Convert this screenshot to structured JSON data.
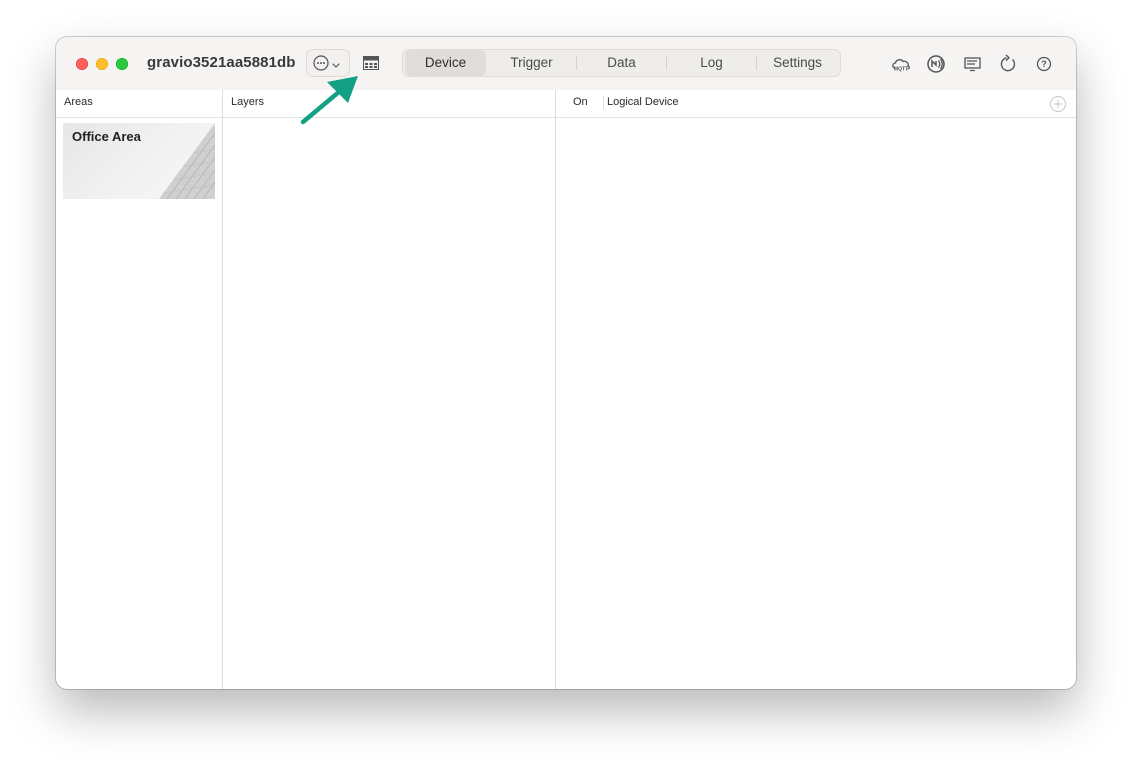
{
  "window": {
    "title": "gravio3521aa5881db"
  },
  "toolbar": {
    "more_icon": "ellipsis-circle-icon",
    "layout_icon": "layout-toggle-icon",
    "tabs": [
      {
        "label": "Device",
        "active": true
      },
      {
        "label": "Trigger",
        "active": false
      },
      {
        "label": "Data",
        "active": false
      },
      {
        "label": "Log",
        "active": false
      },
      {
        "label": "Settings",
        "active": false
      }
    ],
    "right_icons": [
      "mqtt-cloud-icon",
      "nfc-icon",
      "display-icon",
      "refresh-icon",
      "help-icon"
    ]
  },
  "columns": {
    "areas": {
      "header": "Areas"
    },
    "layers": {
      "header": "Layers"
    },
    "devices": {
      "on_header": "On",
      "device_header": "Logical Device"
    }
  },
  "areas": [
    {
      "name": "Office Area"
    }
  ],
  "annotation": {
    "arrow_color": "#14a085"
  }
}
